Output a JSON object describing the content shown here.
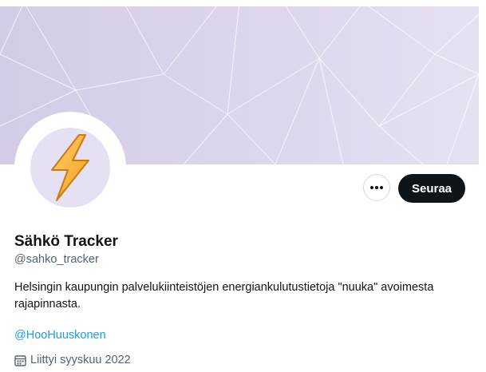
{
  "profile": {
    "display_name": "Sähkö Tracker",
    "handle": "@sahko_tracker",
    "bio": "Helsingin kaupungin palvelukiinteistöjen energiankulutustietoja \"nuuka\" avoimesta rajapinnasta.",
    "mention": "@HooHuuskonen",
    "joined": "Liittyi syyskuu 2022"
  },
  "actions": {
    "follow_label": "Seuraa",
    "more_icon": "more-dots-icon"
  },
  "icons": {
    "avatar": "lightning-bolt-icon",
    "joined": "calendar-icon"
  },
  "colors": {
    "follow_bg": "#0f1419",
    "link": "#1d9bf0",
    "secondary_text": "#536471",
    "banner": "#ddd6ec"
  }
}
